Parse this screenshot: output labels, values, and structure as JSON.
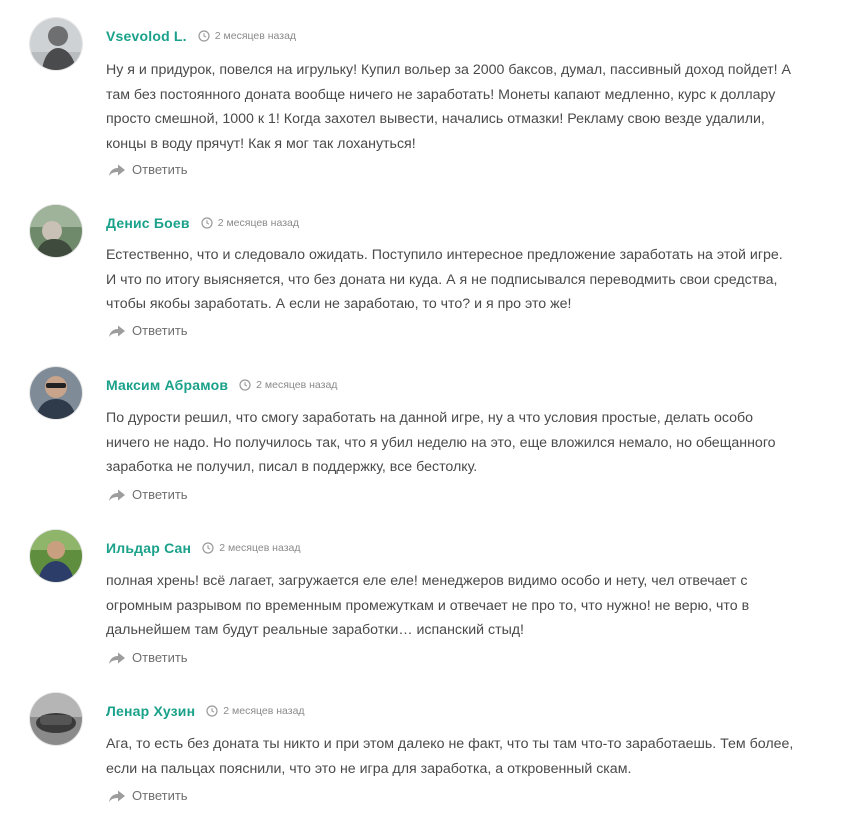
{
  "comments": [
    {
      "author": "Vsevolod L.",
      "time": "2 месяцев назад",
      "text": "Ну я и придурок, повелся на игрульку! Купил вольер за 2000 баксов, думал, пассивный доход пойдет! А там без постоянного доната вообще ничего не заработать! Монеты капают медленно, курс к доллару просто смешной, 1000 к 1! Когда захотел вывести, начались отмазки! Рекламу свою везде удалили, концы в воду прячут! Как я мог так лохануться!",
      "reply_label": "Ответить"
    },
    {
      "author": "Денис Боев",
      "time": "2 месяцев назад",
      "text": "Естественно, что и следовало ожидать. Поступило интересное предложение заработать на этой игре. И что по итогу выясняется, что без доната ни куда. А я не подписывался переводмить свои средства, чтобы якобы заработать. А если не заработаю, то что? и я про это же!",
      "reply_label": "Ответить"
    },
    {
      "author": "Максим Абрамов",
      "time": "2 месяцев назад",
      "text": "По дурости решил, что смогу заработать на данной игре, ну а что условия простые, делать особо ничего не надо. Но получилось так, что я убил неделю на это, еще вложился немало, но обещанного заработка не получил, писал в поддержку, все бестолку.",
      "reply_label": "Ответить"
    },
    {
      "author": "Ильдар Сан",
      "time": "2 месяцев назад",
      "text": "полная хрень! всё лагает, загружается еле еле! менеджеров видимо особо и нету, чел отвечает с огромным разрывом по временным промежуткам и отвечает не про то, что нужно! не верю, что в дальнейшем там будут реальные заработки… испанский стыд!",
      "reply_label": "Ответить"
    },
    {
      "author": "Ленар Хузин",
      "time": "2 месяцев назад",
      "text": "Ага, то есть без доната ты никто и при этом далеко не факт, что ты там что-то заработаешь. Тем более, если на пальцах пояснили, что это не игра для заработка, а откровенный скам.",
      "reply_label": "Ответить"
    }
  ],
  "colors": {
    "author": "#1aa18a",
    "text": "#4a4a4a",
    "meta": "#8a8a8a"
  },
  "icons": {
    "time": "clock-icon",
    "reply": "reply-arrow-icon"
  }
}
